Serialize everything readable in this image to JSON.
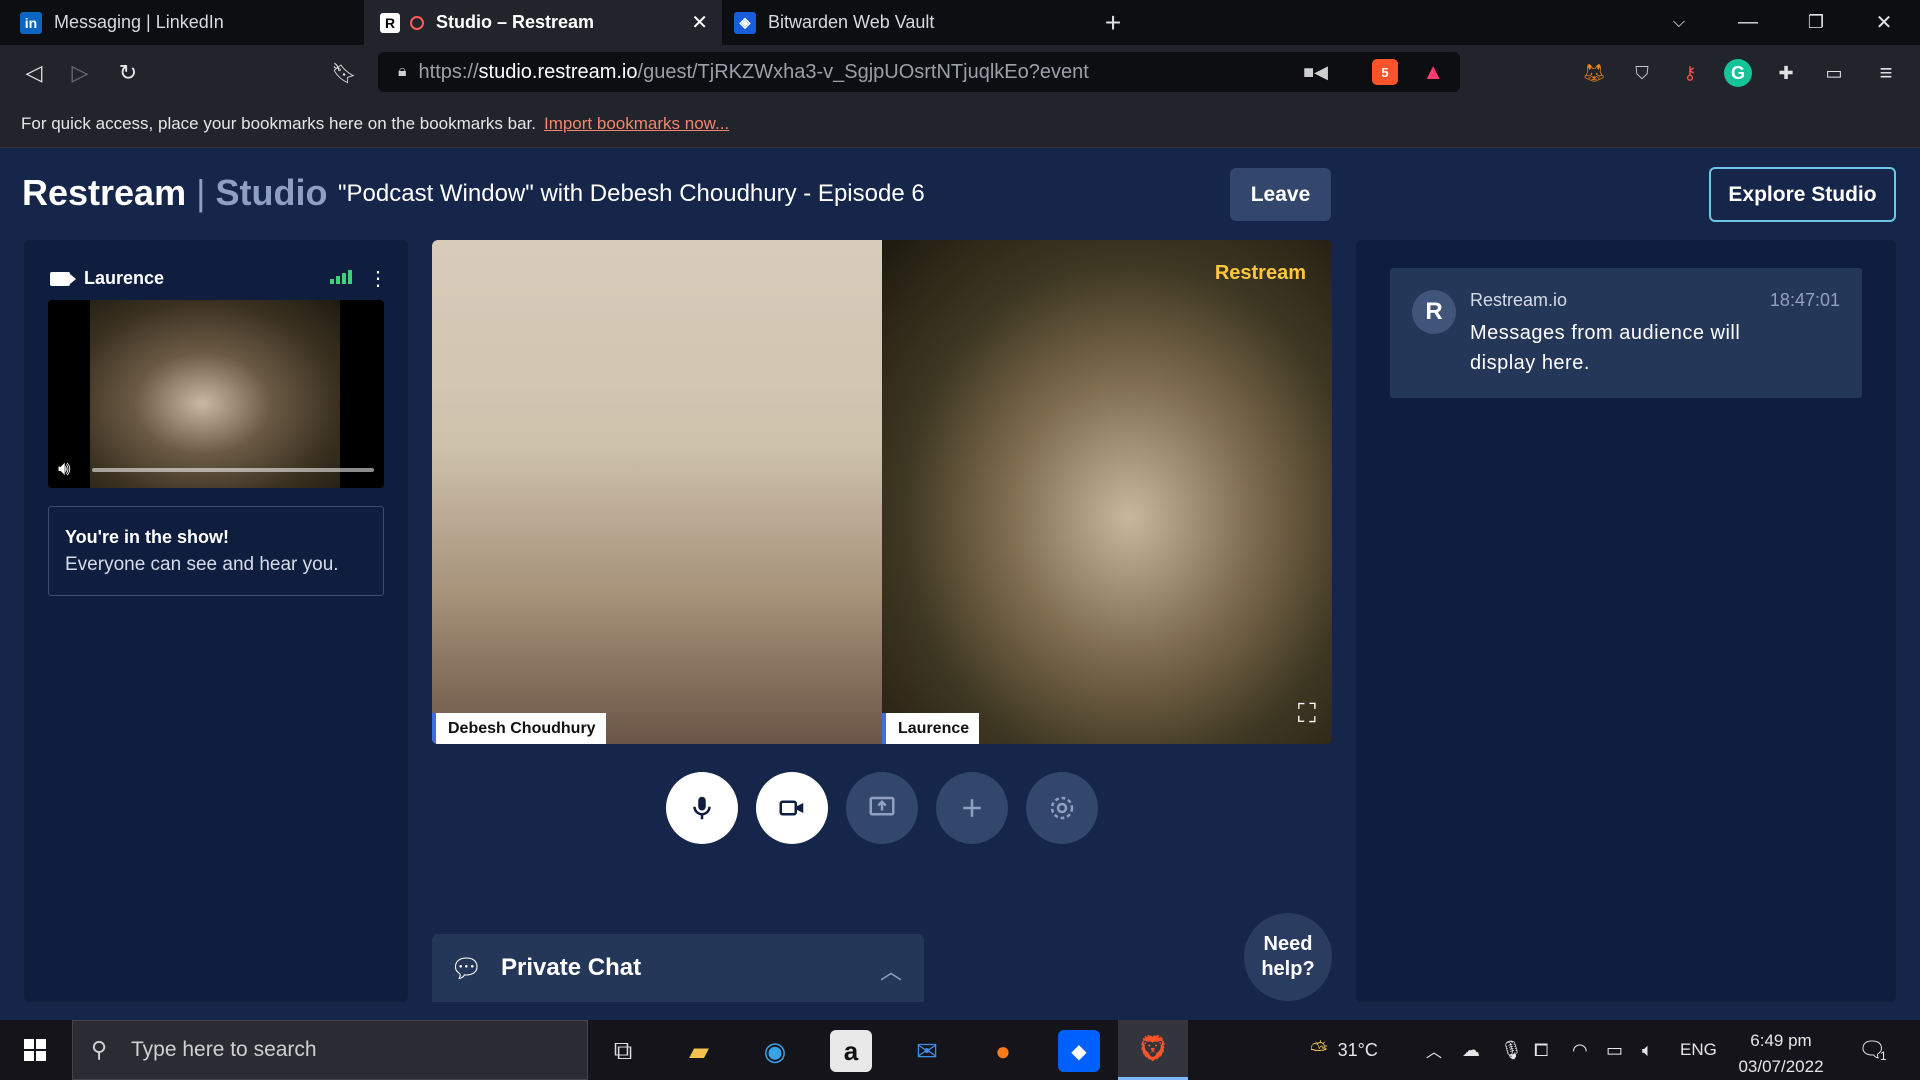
{
  "browser": {
    "tabs": [
      {
        "label": "Messaging | LinkedIn"
      },
      {
        "label": "Studio – Restream"
      },
      {
        "label": "Bitwarden Web Vault"
      }
    ],
    "url_prefix": "https://",
    "url_host": "studio.restream.io",
    "url_path": "/guest/TjRKZWxha3-v_SgjpUOsrtNTjuqlkEo?event",
    "brave_badge": "5",
    "bookmarks_text": "For quick access, place your bookmarks here on the bookmarks bar.",
    "bookmarks_link": "Import bookmarks now..."
  },
  "header": {
    "logo": "Restream",
    "logo_sep": "|",
    "logo_studio": "Studio",
    "event_title": "\"Podcast Window\" with Debesh Choudhury - Episode 6",
    "leave_label": "Leave",
    "explore_label": "Explore Studio"
  },
  "self_panel": {
    "name": "Laurence",
    "show_title": "You're in the show!",
    "show_desc": "Everyone can see and hear you."
  },
  "stage": {
    "brand": "Restream",
    "participants": [
      {
        "name": "Debesh Choudhury"
      },
      {
        "name": "Laurence"
      }
    ]
  },
  "private_chat": {
    "label": "Private Chat"
  },
  "help": {
    "line1": "Need",
    "line2": "help?"
  },
  "chat": {
    "messages": [
      {
        "avatar": "R",
        "sender": "Restream.io",
        "time": "18:47:01",
        "text": "Messages from audience will display here."
      }
    ]
  },
  "taskbar": {
    "search_placeholder": "Type here to search",
    "weather": "31°C",
    "lang": "ENG",
    "time": "6:49 pm",
    "date": "03/07/2022",
    "notif_count": "1"
  },
  "colors": {
    "app_bg": "#15264a",
    "panel_bg": "#0f1e3f",
    "accent": "#6ec6e2",
    "brand_yellow": "#ffc83a"
  }
}
